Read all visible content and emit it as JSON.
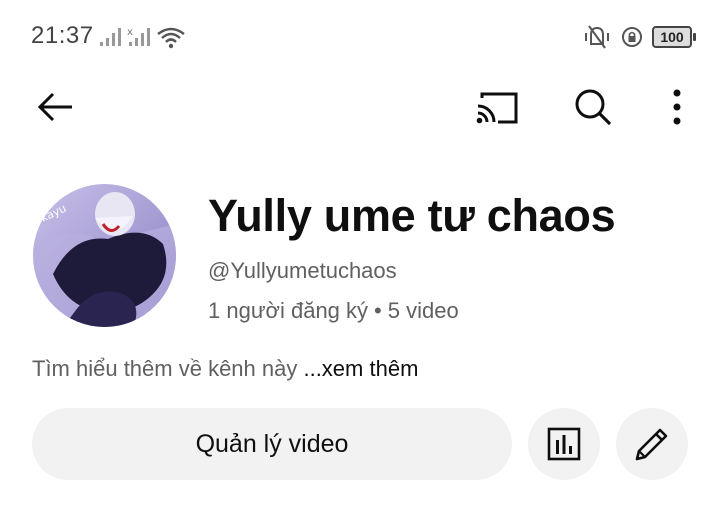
{
  "status_bar": {
    "time": "21:37",
    "battery": "100"
  },
  "top_bar": {
    "icons": [
      "back-arrow-icon",
      "cast-icon",
      "search-icon",
      "more-vertical-icon"
    ]
  },
  "channel": {
    "name": "Yully ume tư chaos",
    "handle": "@Yullyumetuchaos",
    "subscribers": "1 người đăng ký",
    "separator": "•",
    "videos": "5 video",
    "about": "Tìm hiểu thêm về kênh này ",
    "more_link": "...xem thêm"
  },
  "actions": {
    "manage_label": "Quản lý video",
    "icons": [
      "analytics-icon",
      "edit-pencil-icon"
    ]
  },
  "colors": {
    "text_primary": "#0f0f0f",
    "text_secondary": "#606060",
    "button_bg": "#f2f2f2"
  }
}
